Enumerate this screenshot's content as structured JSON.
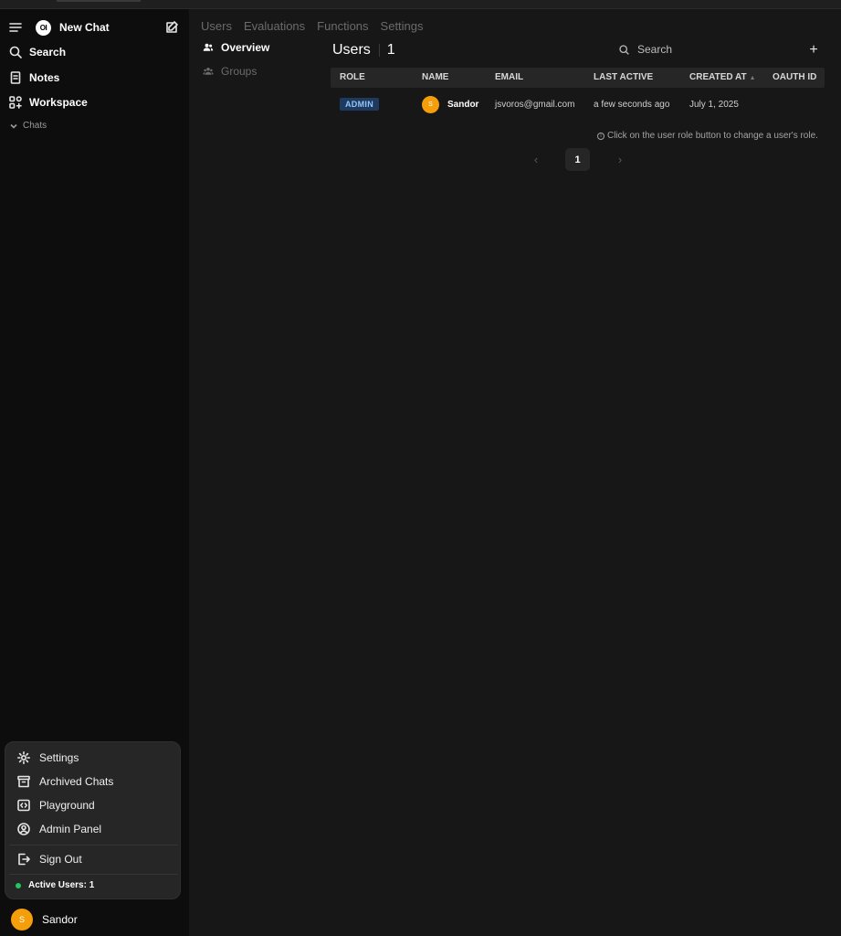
{
  "sidebar": {
    "new_chat": "New Chat",
    "logo_text": "OI",
    "items": [
      {
        "label": "Search",
        "icon": "search-icon"
      },
      {
        "label": "Notes",
        "icon": "notes-icon"
      },
      {
        "label": "Workspace",
        "icon": "workspace-icon"
      }
    ],
    "chats_label": "Chats",
    "user_menu": {
      "items": [
        {
          "label": "Settings",
          "icon": "gear-icon"
        },
        {
          "label": "Archived Chats",
          "icon": "archive-icon"
        },
        {
          "label": "Playground",
          "icon": "code-icon"
        },
        {
          "label": "Admin Panel",
          "icon": "user-circle-icon"
        }
      ],
      "sign_out": "Sign Out",
      "active_users": "Active Users: 1"
    },
    "user": {
      "initial": "S",
      "name": "Sandor"
    }
  },
  "topnav": {
    "tabs": [
      "Users",
      "Evaluations",
      "Functions",
      "Settings"
    ]
  },
  "subnav": {
    "items": [
      {
        "label": "Overview",
        "active": true,
        "icon": "users-icon"
      },
      {
        "label": "Groups",
        "active": false,
        "icon": "group-icon"
      }
    ]
  },
  "users": {
    "title": "Users",
    "count": "1",
    "search_placeholder": "Search",
    "add_label": "+",
    "columns": [
      "ROLE",
      "NAME",
      "EMAIL",
      "LAST ACTIVE",
      "CREATED AT",
      "OAUTH ID"
    ],
    "rows": [
      {
        "role": "ADMIN",
        "avatar_initial": "S",
        "name": "Sandor",
        "email": "jsvoros@gmail.com",
        "last_active": "a few seconds ago",
        "created_at": "July 1, 2025",
        "oauth_id": ""
      }
    ],
    "hint": "Click on the user role button to change a user's role.",
    "pager": {
      "prev": "‹",
      "current": "1",
      "next": "›"
    }
  },
  "colors": {
    "accent_avatar": "#f59e0b",
    "admin_badge_bg": "#1e3a5f",
    "admin_badge_text": "#93c5fd",
    "status_green": "#22c55e"
  }
}
